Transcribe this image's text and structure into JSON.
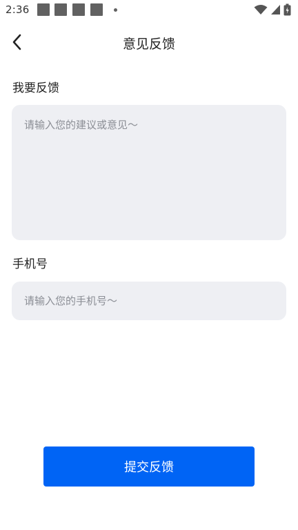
{
  "status_bar": {
    "time": "2:36",
    "notification_icons": [
      "notification-icon",
      "notification-icon",
      "notification-icon",
      "notification-icon"
    ],
    "right_icons": [
      "wifi-icon",
      "signal-icon",
      "battery-icon"
    ]
  },
  "header": {
    "title": "意见反馈",
    "back_icon": "chevron-left-icon"
  },
  "form": {
    "feedback_label": "我要反馈",
    "feedback_value": "",
    "feedback_placeholder": "请输入您的建议或意见～",
    "phone_label": "手机号",
    "phone_value": "",
    "phone_placeholder": "请输入您的手机号～"
  },
  "submit": {
    "label": "提交反馈"
  },
  "colors": {
    "accent": "#0064f5",
    "input_background": "#eeeff3",
    "placeholder": "#8b8e95",
    "text": "#222222"
  }
}
